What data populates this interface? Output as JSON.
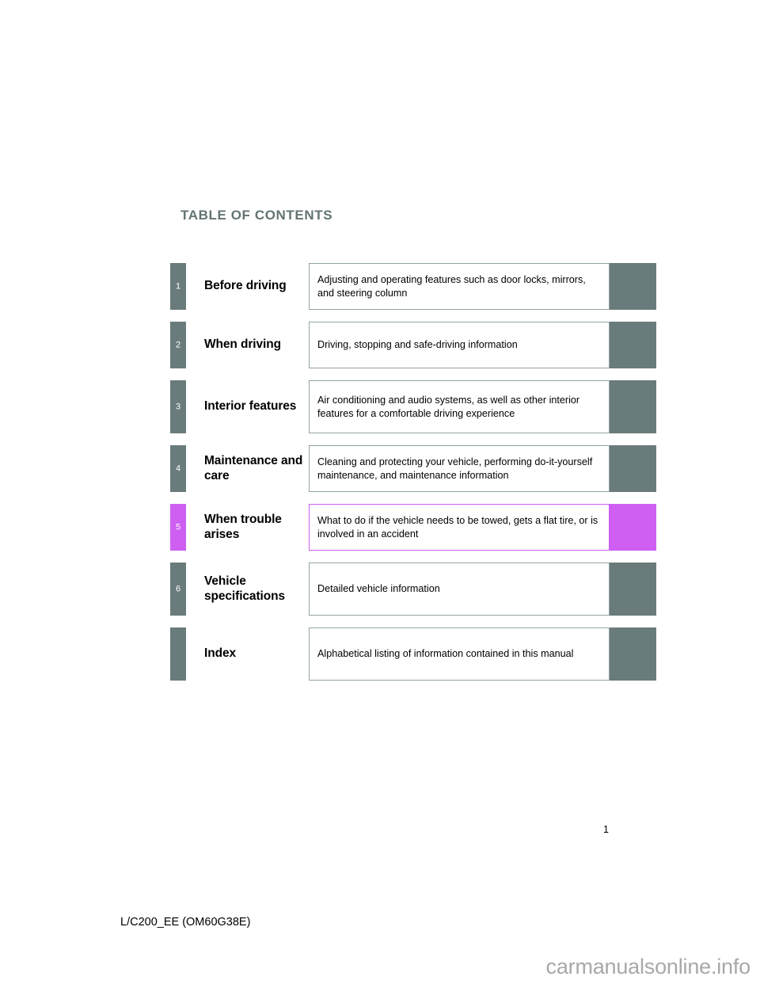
{
  "page": {
    "title": "TABLE OF CONTENTS",
    "page_number": "1",
    "footer_code": "L/C200_EE (OM60G38E)",
    "watermark": "carmanualsonline.info"
  },
  "colors": {
    "tab_default": "#6a7b7b",
    "tab_accent": "#ce5ff2",
    "heading": "#637373",
    "desc_border": "#93a3a3",
    "watermark": "#a8a8a8"
  },
  "toc": {
    "rows": [
      {
        "number": "1",
        "title": "Before driving",
        "description": "Adjusting and operating features such as door locks, mirrors, and steering column",
        "highlighted": false,
        "height": "h-short"
      },
      {
        "number": "2",
        "title": "When driving",
        "description": "Driving, stopping and safe-driving information",
        "highlighted": false,
        "height": "h-short"
      },
      {
        "number": "3",
        "title": "Interior features",
        "description": "Air conditioning and audio systems, as well as other interior features for a comfortable driving experience",
        "highlighted": false,
        "height": "h-tall"
      },
      {
        "number": "4",
        "title": "Maintenance and care",
        "description": "Cleaning and protecting your vehicle, performing do-it-yourself maintenance, and maintenance information",
        "highlighted": false,
        "height": "h-short"
      },
      {
        "number": "5",
        "title": "When trouble arises",
        "description": "What to do if the vehicle needs to be towed, gets a flat tire, or is involved in an accident",
        "highlighted": true,
        "height": "h-short"
      },
      {
        "number": "6",
        "title": "Vehicle specifications",
        "description": "Detailed vehicle information",
        "highlighted": false,
        "height": "h-tall"
      },
      {
        "number": "",
        "title": "Index",
        "description": "Alphabetical listing of information contained in this manual",
        "highlighted": false,
        "height": "h-tall"
      }
    ]
  }
}
